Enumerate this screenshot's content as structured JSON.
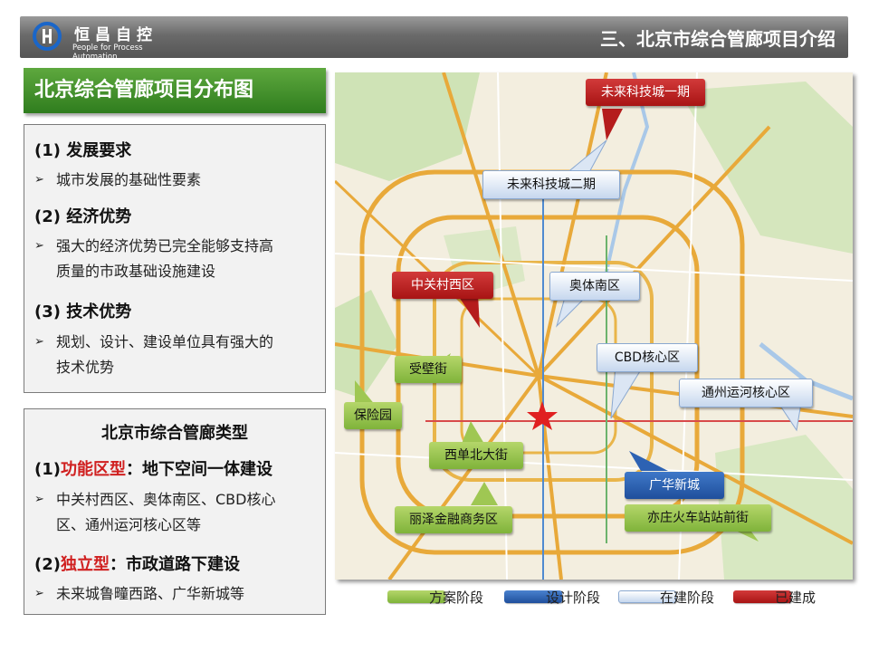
{
  "header": {
    "company_name": "恒昌自控",
    "company_tagline": "People for Process Automation",
    "section_title": "三、北京市综合管廊项目介绍"
  },
  "title": "北京综合管廊项目分布图",
  "panel1": {
    "h1": "(1) 发展要求",
    "b1": [
      "城市发展的基础性要素"
    ],
    "h2": "(2) 经济优势",
    "b2": [
      "强大的经济优势已完全能够支持高",
      "质量的市政基础设施建设"
    ],
    "h3": "(3) 技术优势",
    "b3": [
      "规划、设计、建设单位具有强大的",
      "技术优势"
    ]
  },
  "panel2": {
    "title": "北京市综合管廊类型",
    "t1_prefix": "(1)",
    "t1_red": "功能区型",
    "t1_rest": "：地下空间一体建设",
    "b1": [
      "中关村西区、奥体南区、CBD核心",
      "区、通州运河核心区等"
    ],
    "t2_prefix": "(2)",
    "t2_red": "独立型",
    "t2_rest": "：市政道路下建设",
    "b2": [
      "未来城鲁疃西路、广华新城等"
    ]
  },
  "map_tags": {
    "future_city_1": "未来科技城一期",
    "future_city_2": "未来科技城二期",
    "zhongguancun_west": "中关村西区",
    "olympic_south": "奥体南区",
    "cbd_core": "CBD核心区",
    "tongzhou_canal": "通州运河核心区",
    "shoubi_street": "受壁街",
    "baoxian_garden": "保险园",
    "xidan_north": "西单北大街",
    "guanghua_new_city": "广华新城",
    "lize_finance": "丽泽金融商务区",
    "yizhuang_station": "亦庄火车站站前街"
  },
  "legend": {
    "plan": "方案阶段",
    "design": "设计阶段",
    "construction": "在建阶段",
    "built": "已建成"
  },
  "colors": {
    "plan": "#8cbf3f",
    "design": "#2d62b3",
    "construction": "#dfe8f5",
    "built": "#c42020",
    "title_green": "#3e8c25"
  }
}
